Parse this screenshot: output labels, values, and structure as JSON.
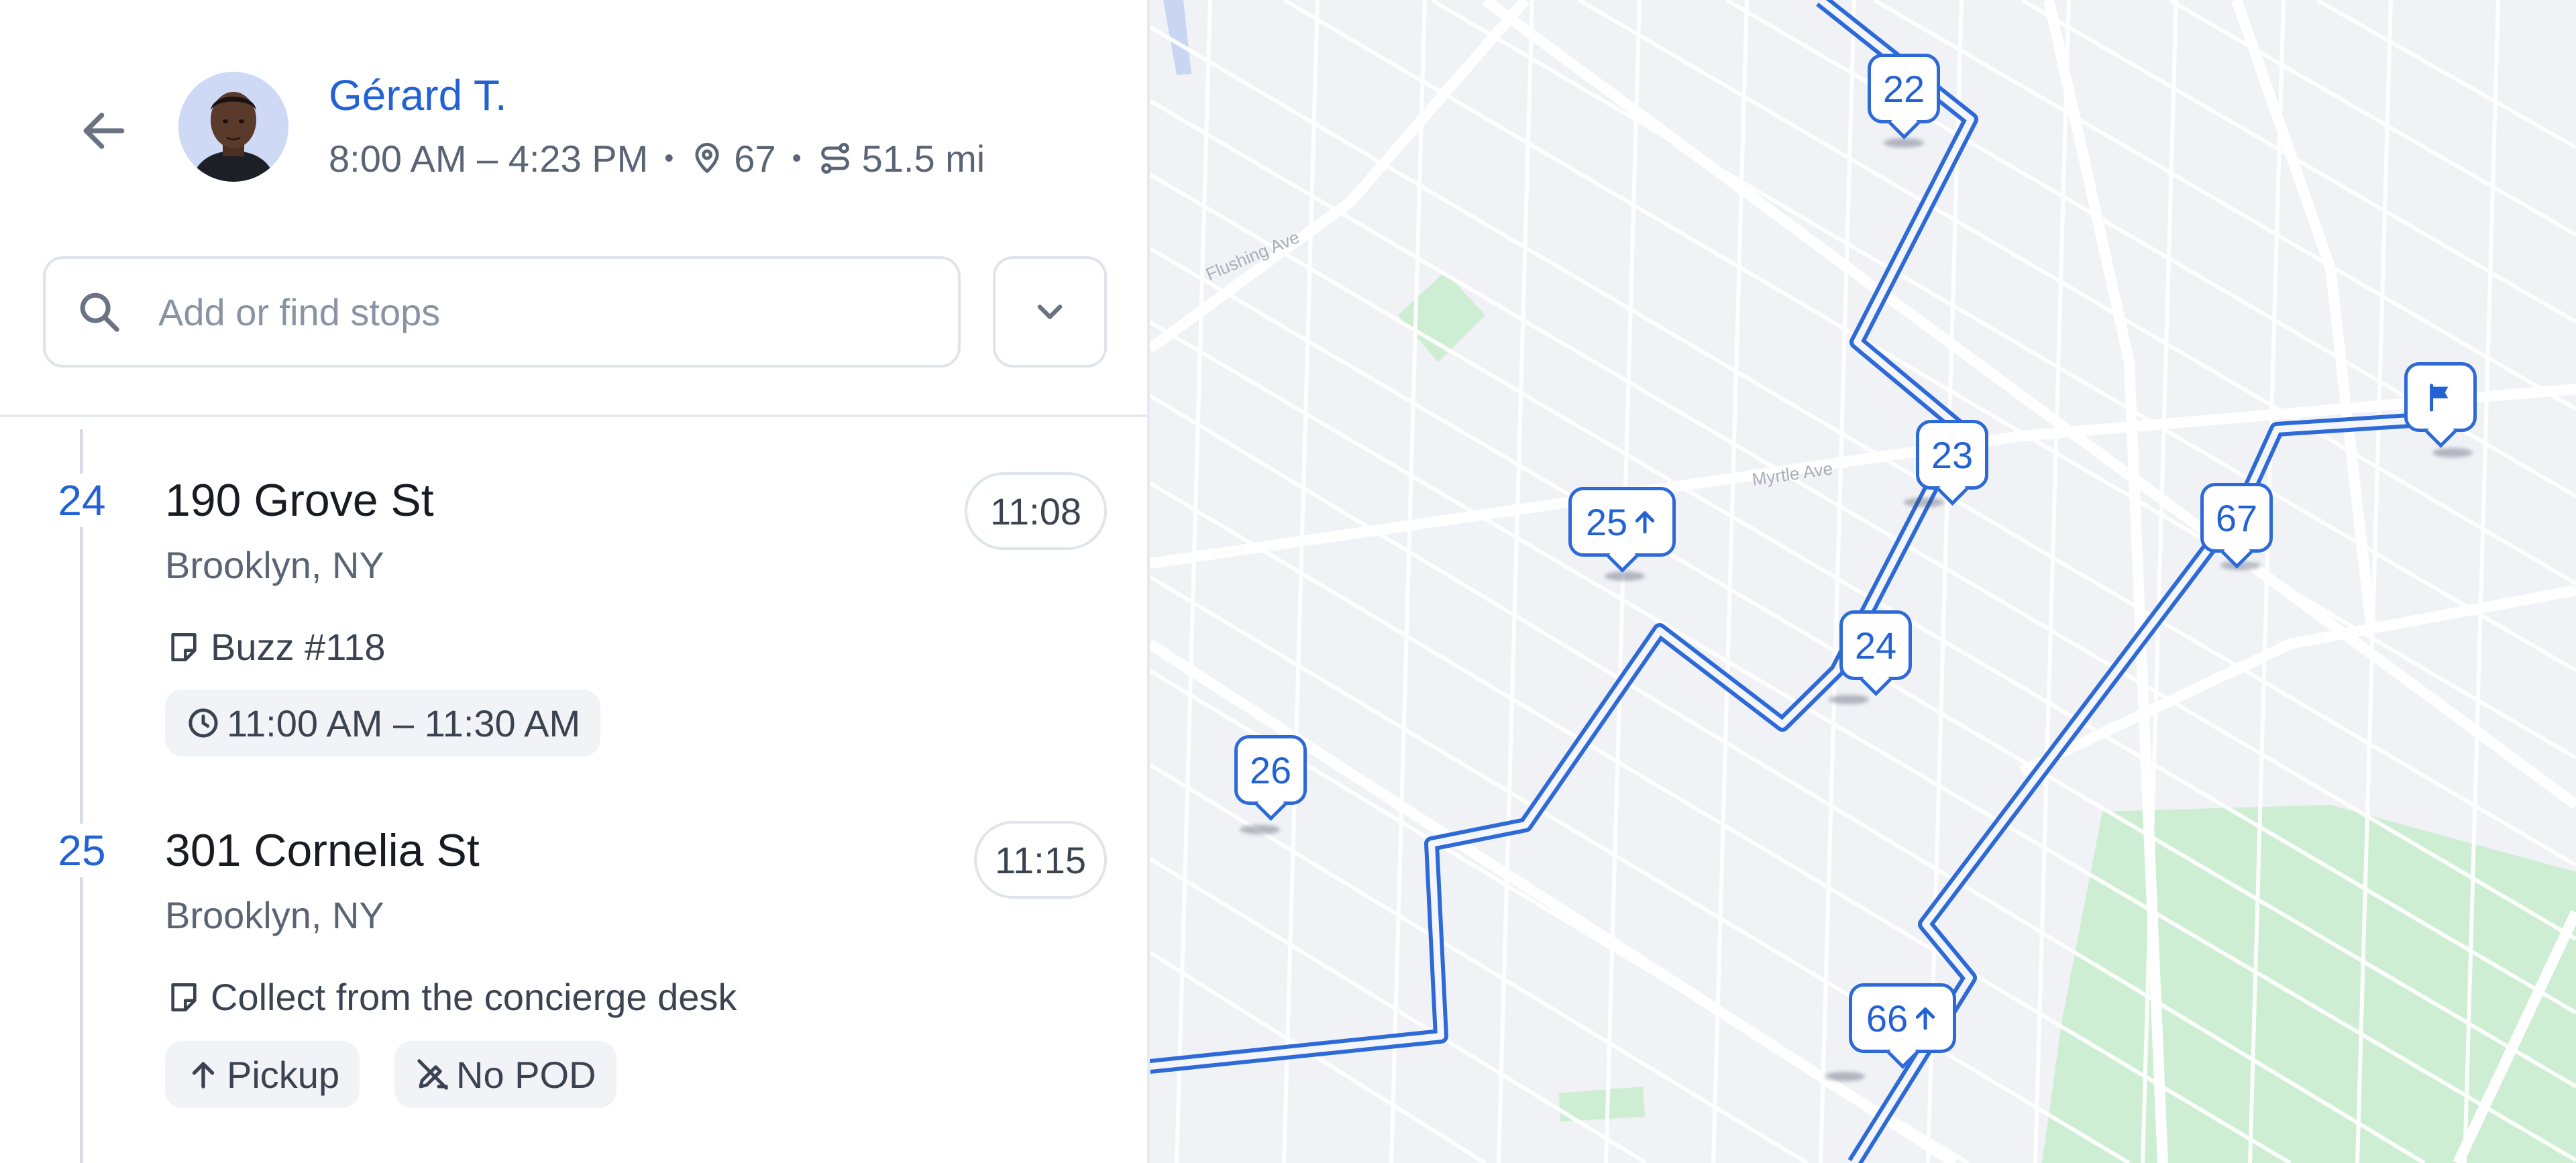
{
  "colors": {
    "accent": "#2362d4",
    "route": "#2d6ad8",
    "park": "#cdeed3",
    "map_bg": "#f1f2f6"
  },
  "header": {
    "back_icon": "arrow-left-icon",
    "driver_name": "Gérard T.",
    "shift": "8:00 AM – 4:23 PM",
    "stop_count": "67",
    "distance": "51.5 mi",
    "stop_count_icon": "map-pin-icon",
    "distance_icon": "route-icon"
  },
  "search": {
    "placeholder": "Add or find stops",
    "icon": "search-icon",
    "dropdown_icon": "chevron-down-icon"
  },
  "stops": [
    {
      "number": "24",
      "street": "190 Grove St",
      "city": "Brooklyn, NY",
      "eta": "11:08",
      "note": "Buzz #118",
      "chips": [
        {
          "icon": "clock-icon",
          "label": "11:00 AM – 11:30 AM"
        }
      ]
    },
    {
      "number": "25",
      "street": "301 Cornelia St",
      "city": "Brooklyn, NY",
      "eta": "11:15",
      "note": "Collect from the concierge desk",
      "chips": [
        {
          "icon": "arrow-up-icon",
          "label": "Pickup"
        },
        {
          "icon": "no-camera-icon",
          "label": "No POD"
        }
      ]
    }
  ],
  "map": {
    "street_labels": [
      "Flushing Ave",
      "Myrtle Ave"
    ],
    "markers": [
      {
        "label": "22",
        "pickup": false
      },
      {
        "label": "23",
        "pickup": false
      },
      {
        "label": "25",
        "pickup": true
      },
      {
        "label": "24",
        "pickup": false
      },
      {
        "label": "26",
        "pickup": false
      },
      {
        "label": "67",
        "pickup": false
      },
      {
        "label": "66",
        "pickup": true
      }
    ],
    "end_marker_icon": "flag-icon"
  }
}
